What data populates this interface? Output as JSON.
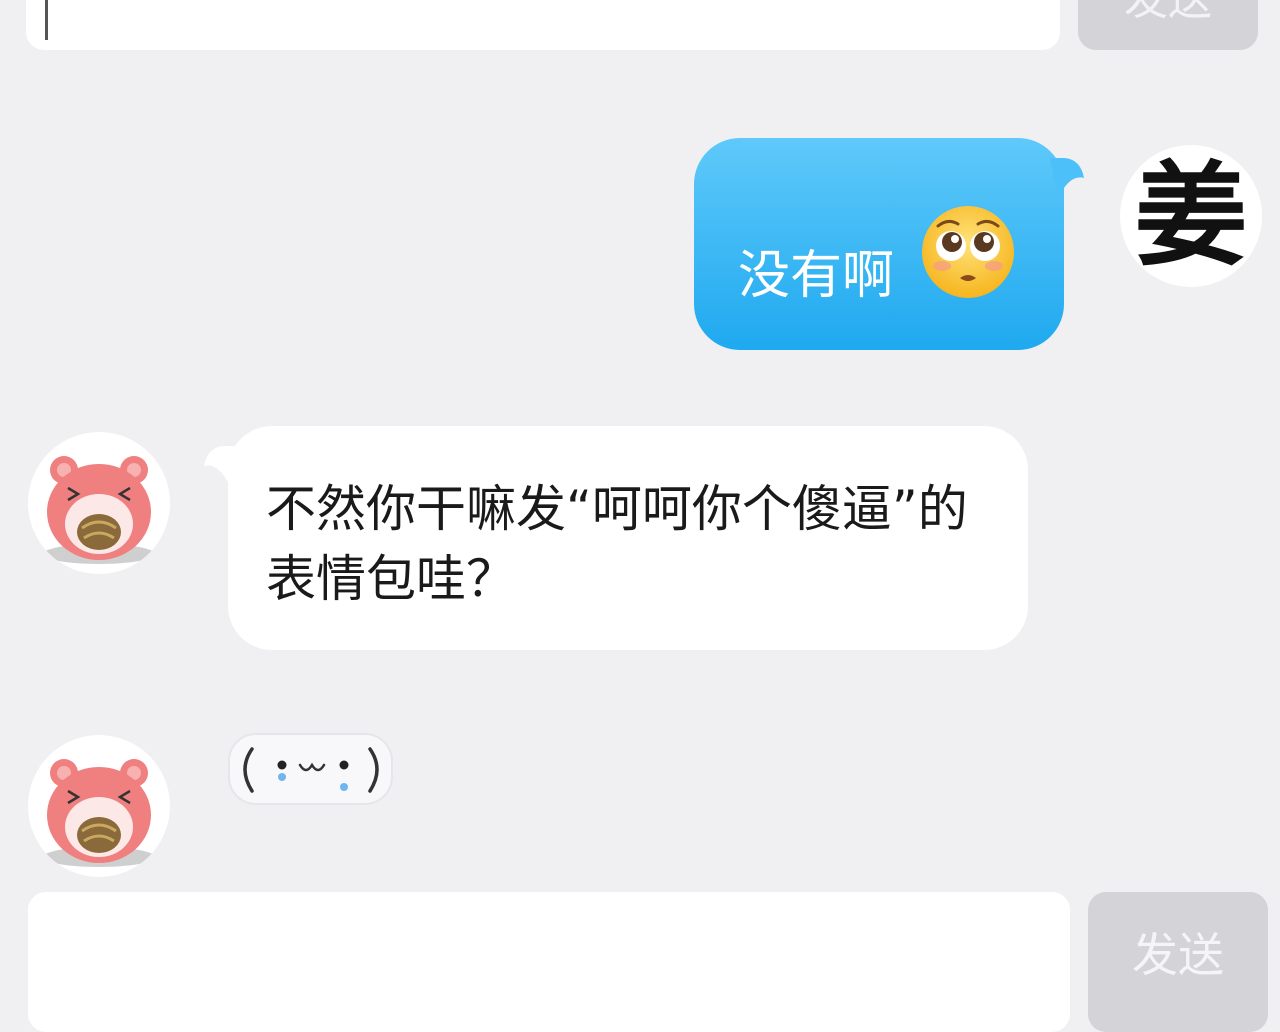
{
  "top_bar": {
    "send_label": "发送"
  },
  "contacts": {
    "me": {
      "avatar_char": "姜"
    }
  },
  "messages": [
    {
      "side": "right",
      "text": "没有啊",
      "emoji": "pleading-face-emoji"
    },
    {
      "side": "left",
      "text": "不然你干嘛发“呵呵你个傻逼”的表情包哇？"
    },
    {
      "side": "left",
      "sticker": "kaomoji-sticker"
    }
  ],
  "composer": {
    "send_label": "发送",
    "placeholder": ""
  },
  "colors": {
    "background": "#f0f0f3",
    "bubble_self": "#1fa9ef",
    "bubble_other": "#ffffff",
    "send_button": "#d4d4d8"
  }
}
